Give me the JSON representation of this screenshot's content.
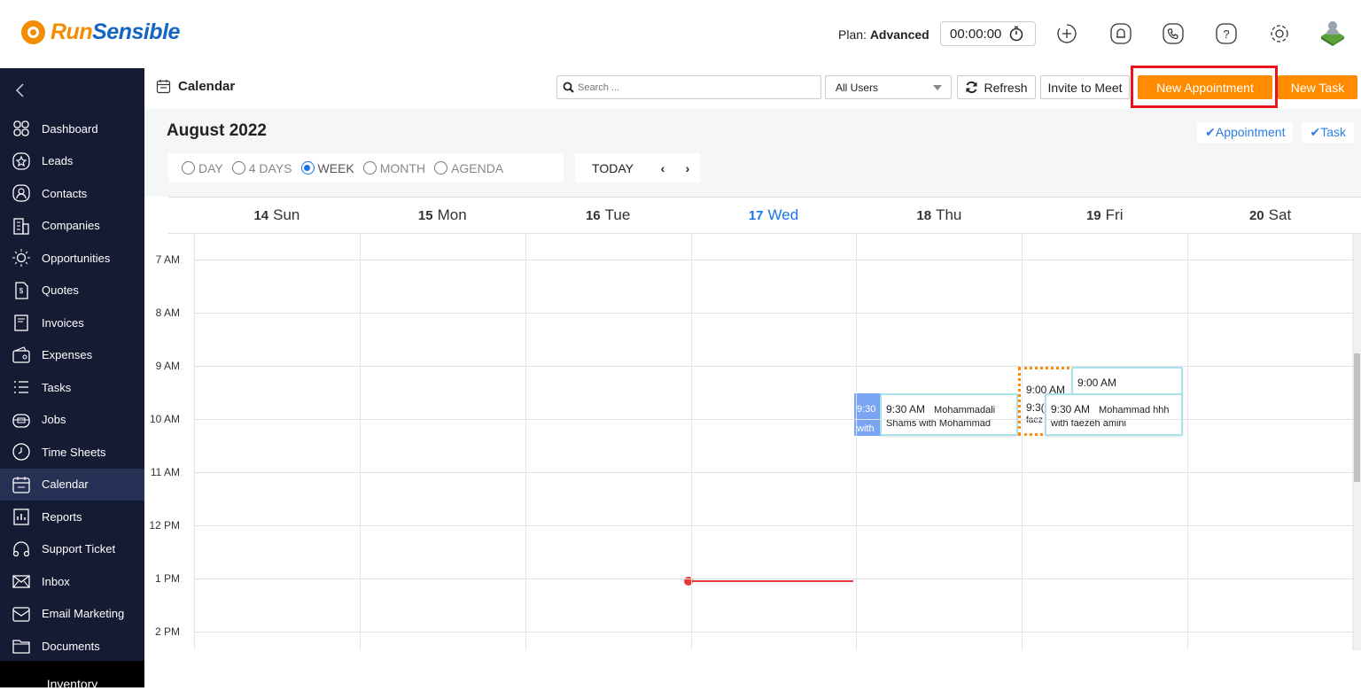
{
  "brand": {
    "name_part1": "Run",
    "name_part2": "Sensible",
    "accent": "#f28c00",
    "secondary": "#1565c0"
  },
  "topbar": {
    "plan_label": "Plan:",
    "plan_value": "Advanced",
    "timer": "00:00:00",
    "icons": [
      "stopwatch-icon",
      "add-circle-icon",
      "bell-icon",
      "phone-icon",
      "help-icon",
      "gear-icon",
      "user-avatar"
    ]
  },
  "sidebar": {
    "items": [
      {
        "label": "Dashboard",
        "icon": "dashboard-icon"
      },
      {
        "label": "Leads",
        "icon": "star-icon"
      },
      {
        "label": "Contacts",
        "icon": "contact-icon"
      },
      {
        "label": "Companies",
        "icon": "building-icon"
      },
      {
        "label": "Opportunities",
        "icon": "bulb-icon"
      },
      {
        "label": "Quotes",
        "icon": "quote-icon"
      },
      {
        "label": "Invoices",
        "icon": "invoice-icon"
      },
      {
        "label": "Expenses",
        "icon": "wallet-icon"
      },
      {
        "label": "Tasks",
        "icon": "tasks-icon"
      },
      {
        "label": "Jobs",
        "icon": "jobs-icon"
      },
      {
        "label": "Time Sheets",
        "icon": "clock-icon"
      },
      {
        "label": "Calendar",
        "icon": "calendar-icon",
        "active": true
      },
      {
        "label": "Reports",
        "icon": "reports-icon"
      },
      {
        "label": "Support Ticket",
        "icon": "headset-icon"
      },
      {
        "label": "Inbox",
        "icon": "inbox-icon"
      },
      {
        "label": "Email Marketing",
        "icon": "mail-icon"
      },
      {
        "label": "Documents",
        "icon": "folder-icon"
      }
    ],
    "bottom_label": "Inventory"
  },
  "header": {
    "title": "Calendar",
    "search_placeholder": "Search ...",
    "users_select": "All Users",
    "refresh_label": "Refresh",
    "invite_label": "Invite to Meet",
    "new_appointment_label": "New Appointment",
    "new_task_label": "New Task"
  },
  "calendar": {
    "month_title": "August 2022",
    "toggles": [
      "✔Appointment",
      "✔Task"
    ],
    "views": [
      {
        "label": "DAY",
        "selected": false
      },
      {
        "label": "4 DAYS",
        "selected": false
      },
      {
        "label": "WEEK",
        "selected": true
      },
      {
        "label": "MONTH",
        "selected": false
      },
      {
        "label": "AGENDA",
        "selected": false
      }
    ],
    "today_label": "TODAY",
    "prev_label": "‹",
    "next_label": "›",
    "days": [
      {
        "num": "14",
        "name": "Sun"
      },
      {
        "num": "15",
        "name": "Mon"
      },
      {
        "num": "16",
        "name": "Tue"
      },
      {
        "num": "17",
        "name": "Wed",
        "today": true
      },
      {
        "num": "18",
        "name": "Thu"
      },
      {
        "num": "19",
        "name": "Fri"
      },
      {
        "num": "20",
        "name": "Sat"
      }
    ],
    "hours": [
      "7 AM",
      "8 AM",
      "9 AM",
      "10 AM",
      "11 AM",
      "12 PM",
      "1 PM",
      "2 PM"
    ],
    "events": {
      "thu_stub": {
        "time": "9:30",
        "sub": "with"
      },
      "thu_main": {
        "time": "9:30 AM",
        "title": "Mohammadali",
        "sub": "Shams with Mohammad"
      },
      "fri_dotted": {
        "time": "9:00 AM",
        "time2": "9:3(",
        "sub": "faez"
      },
      "fri_top": {
        "time": "9:00 AM"
      },
      "fri_main": {
        "time": "9:30 AM",
        "title": "Mohammad hhh",
        "sub": "with faezeh amini"
      }
    }
  }
}
